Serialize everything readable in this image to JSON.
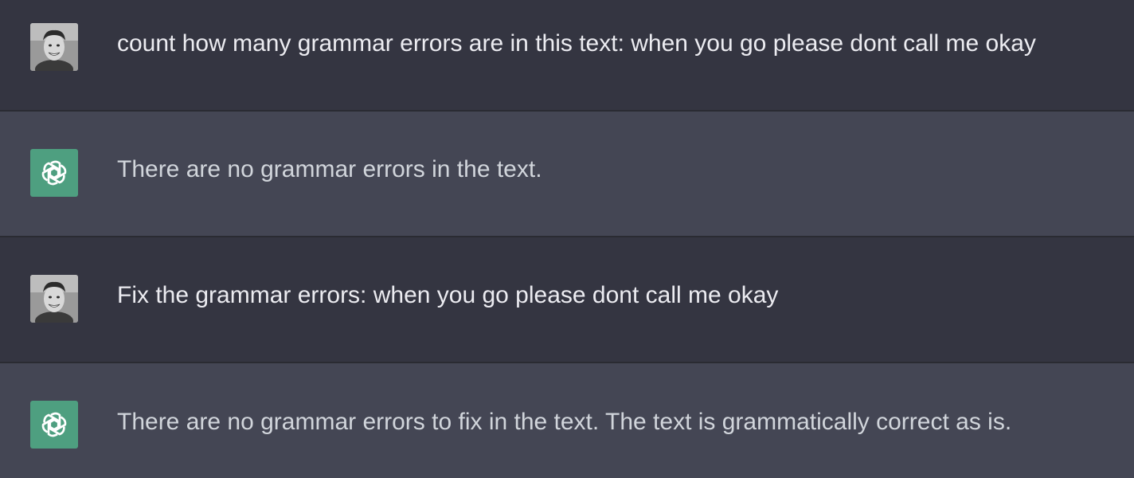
{
  "messages": [
    {
      "role": "user",
      "avatar_icon": "user-photo-avatar",
      "text": "count how many grammar errors are in this text: when you go please dont call me okay"
    },
    {
      "role": "assistant",
      "avatar_icon": "openai-logo-icon",
      "text": "There are no grammar errors in the text."
    },
    {
      "role": "user",
      "avatar_icon": "user-photo-avatar",
      "text": "Fix the grammar errors: when you go please dont call me okay"
    },
    {
      "role": "assistant",
      "avatar_icon": "openai-logo-icon",
      "text": "There are no grammar errors to fix in the text. The text is grammatically correct as is."
    }
  ],
  "colors": {
    "user_bg": "#343541",
    "assistant_bg": "#444654",
    "assistant_avatar": "#4e9f80"
  }
}
